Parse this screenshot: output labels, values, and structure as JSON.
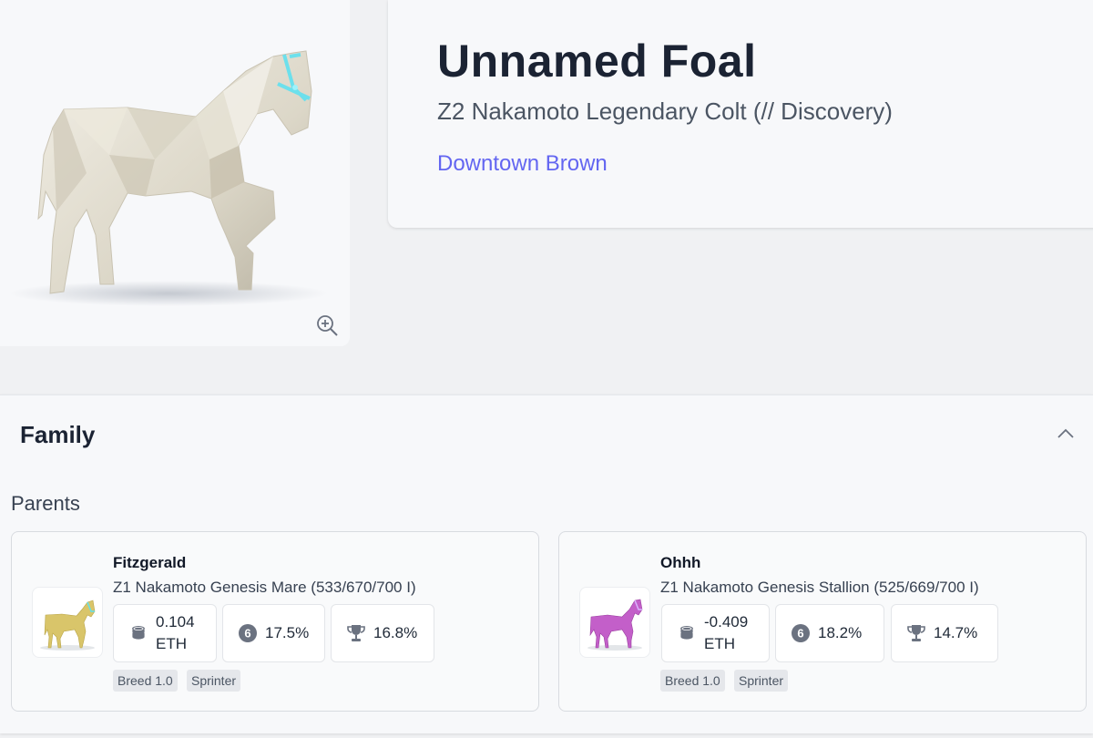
{
  "horse": {
    "name": "Unnamed Foal",
    "subtitle": "Z2 Nakamoto Legendary Colt (// Discovery)",
    "owner": "Downtown Brown",
    "coat_color": "#e8e4d8",
    "accent_color": "#5fe0f0",
    "zoom_icon": "zoom-in-icon"
  },
  "family": {
    "title": "Family",
    "parents_label": "Parents",
    "collapse_icon": "chevron-up-icon",
    "parents": [
      {
        "name": "Fitzgerald",
        "description": "Z1 Nakamoto Genesis Mare (533/670/700 I)",
        "coat_color": "#d9c56a",
        "earnings_value": "0.104",
        "earnings_unit": "ETH",
        "earnings_icon": "coins-icon",
        "win_rate": "17.5%",
        "win_rate_icon": "number-six-badge-icon",
        "place_rate": "16.8%",
        "place_rate_icon": "trophy-icon",
        "tags": [
          "Breed 1.0",
          "Sprinter"
        ]
      },
      {
        "name": "Ohhh",
        "description": "Z1 Nakamoto Genesis Stallion (525/669/700 I)",
        "coat_color": "#c35fc9",
        "earnings_value": "-0.409",
        "earnings_unit": "ETH",
        "earnings_icon": "coins-icon",
        "win_rate": "18.2%",
        "win_rate_icon": "number-six-badge-icon",
        "place_rate": "14.7%",
        "place_rate_icon": "trophy-icon",
        "tags": [
          "Breed 1.0",
          "Sprinter"
        ]
      }
    ]
  }
}
